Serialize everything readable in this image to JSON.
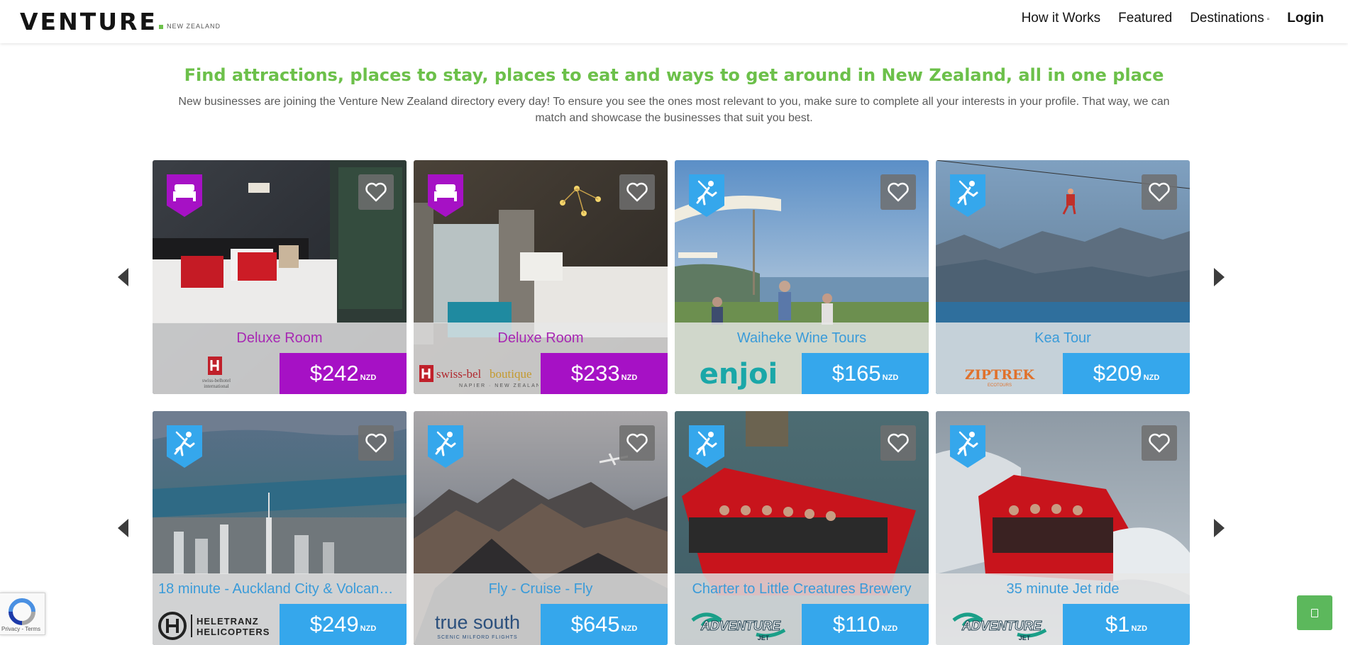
{
  "header": {
    "logo_main": "VENTURE",
    "logo_sub": "NEW ZEALAND",
    "nav": [
      "How it Works",
      "Featured",
      "Destinations",
      "Login"
    ]
  },
  "intro": {
    "headline": "Find attractions, places to stay, places to eat and ways to get around in New Zealand, all in one place",
    "body": "New businesses are joining the Venture New Zealand directory every day! To ensure you see the ones most relevant to you, make sure to complete all your interests in your profile. That way, we can match and showcase the businesses that suit you best."
  },
  "rows": [
    [
      {
        "title": "Deluxe Room",
        "price": "$242",
        "currency": "NZD",
        "category": "accommodation",
        "logo": "swiss-belhotel international",
        "icon": "bed-icon"
      },
      {
        "title": "Deluxe Room",
        "price": "$233",
        "currency": "NZD",
        "category": "accommodation",
        "logo": "swiss-belboutique",
        "icon": "bed-icon"
      },
      {
        "title": "Waiheke Wine Tours",
        "price": "$165",
        "currency": "NZD",
        "category": "activity",
        "logo": "enjoi",
        "icon": "activity-icon"
      },
      {
        "title": "Kea Tour",
        "price": "$209",
        "currency": "NZD",
        "category": "activity",
        "logo": "ZIPTREK",
        "icon": "activity-icon"
      }
    ],
    [
      {
        "title": "18 minute - Auckland City & Volcanoe...",
        "price": "$249",
        "currency": "NZD",
        "category": "activity",
        "logo": "HELETRANZ HELICOPTERS",
        "icon": "activity-icon"
      },
      {
        "title": "Fly - Cruise - Fly",
        "price": "$645",
        "currency": "NZD",
        "category": "activity",
        "logo": "true south SCENIC MILFORD FLIGHTS",
        "icon": "activity-icon"
      },
      {
        "title": "Charter to Little Creatures Brewery",
        "price": "$110",
        "currency": "NZD",
        "category": "activity",
        "logo": "ADVENTURE JET",
        "icon": "activity-icon"
      },
      {
        "title": "35 minute Jet ride",
        "price": "$1",
        "currency": "NZD",
        "category": "activity",
        "logo": "ADVENTURE JET",
        "icon": "activity-icon"
      }
    ]
  ],
  "recaptcha": {
    "text": "Privacy - Terms"
  },
  "colors": {
    "brand_green": "#6cc04a",
    "accommodation": "#a611c5",
    "activity": "#35a7ec"
  }
}
